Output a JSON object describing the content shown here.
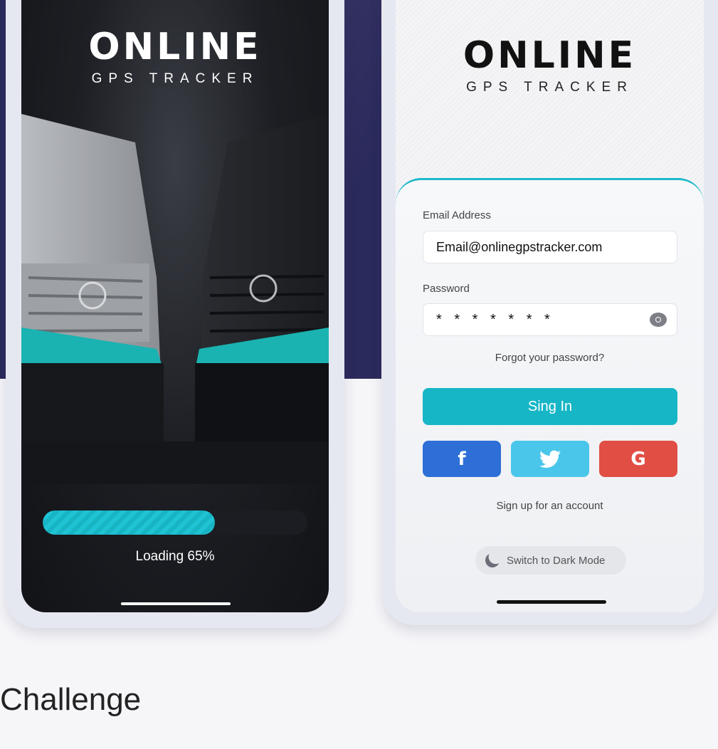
{
  "splash": {
    "logo_text": "ONLINE",
    "logo_subtitle": "GPS TRACKER",
    "progress_percent": 65,
    "loading_label": "Loading 65%"
  },
  "login": {
    "logo_text": "ONLINE",
    "logo_subtitle": "GPS TRACKER",
    "email_label": "Email Address",
    "email_value": "Email@onlinegpstracker.com",
    "password_label": "Password",
    "password_value": "* * * * * * *",
    "forgot_label": "Forgot your password?",
    "signin_label": "Sing In",
    "social": [
      {
        "icon": "facebook-icon",
        "glyph": "f",
        "color": "#2d6fd7"
      },
      {
        "icon": "twitter-icon",
        "glyph": "🐦",
        "color": "#4ac6ea"
      },
      {
        "icon": "google-icon",
        "glyph": "G",
        "color": "#e14e44"
      }
    ],
    "signup_label": "Sign up for an account",
    "dark_mode_label": "Switch to Dark Mode",
    "accent_color": "#16b6c6"
  },
  "section_heading": "Challenge"
}
